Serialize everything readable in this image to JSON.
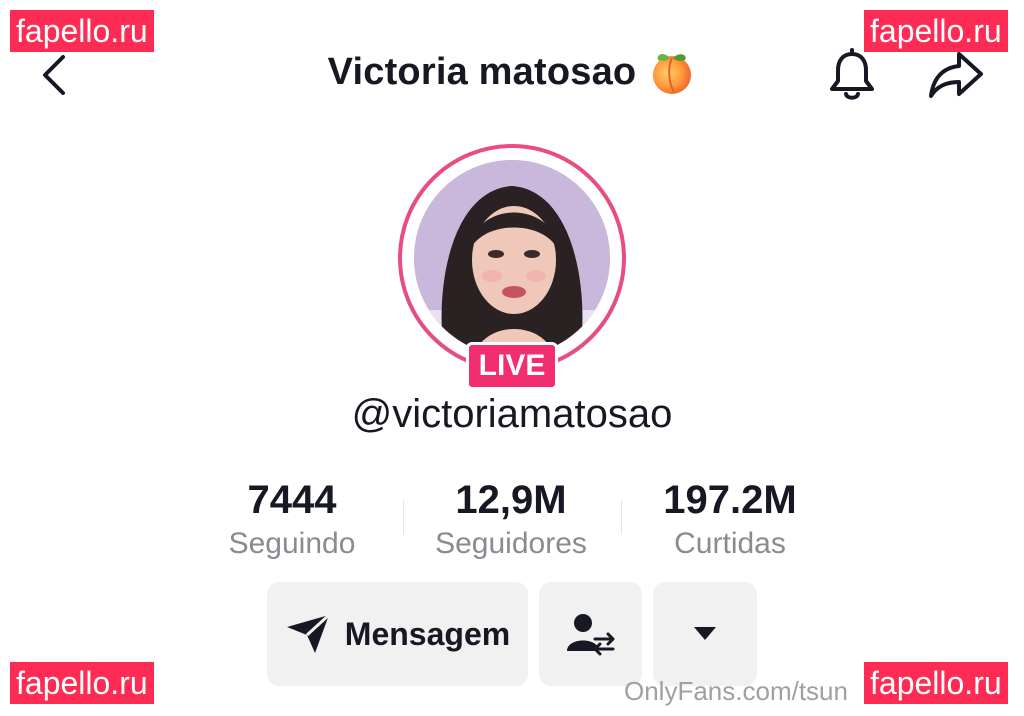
{
  "header": {
    "title": "Victoria matosao",
    "back_icon": "chevron-left-icon",
    "bell_icon": "bell-icon",
    "share_icon": "share-arrow-icon"
  },
  "profile": {
    "live_badge": "LIVE",
    "handle": "@victoriamatosao"
  },
  "stats": [
    {
      "value": "7444",
      "label": "Seguindo"
    },
    {
      "value": "12,9M",
      "label": "Seguidores"
    },
    {
      "value": "197.2M",
      "label": "Curtidas"
    }
  ],
  "actions": {
    "message_label": "Mensagem",
    "message_icon": "send-plane-icon",
    "friend_icon": "user-swap-icon",
    "more_icon": "caret-down-icon"
  },
  "watermarks": {
    "site": "fapello.ru",
    "footer": "OnlyFans.com/tsun"
  },
  "colors": {
    "live_pink": "#f12e6e",
    "ring_pink": "#e84e7d",
    "watermark_red": "#fe2b54",
    "button_bg": "#f1f1f2"
  }
}
